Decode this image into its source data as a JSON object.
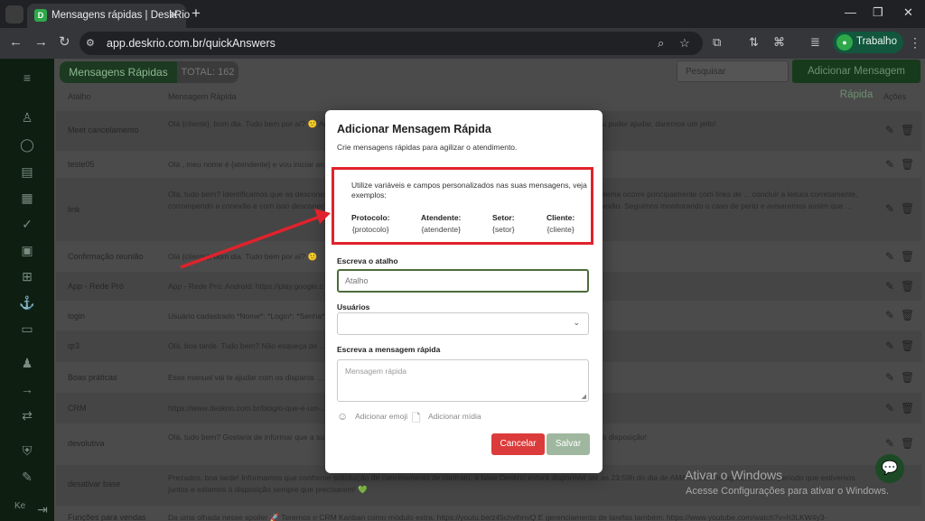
{
  "browser": {
    "tab_title": "Mensagens rápidas | DeskRio",
    "url": "app.deskrio.com.br/quickAnswers",
    "profile_label": "Trabalho",
    "tab_list_icon": "chevron-down-icon",
    "new_tab_label": "+",
    "tab_close_label": "✕"
  },
  "header": {
    "title": "Mensagens Rápidas",
    "total": "TOTAL: 162",
    "search_placeholder": "Pesquisar",
    "add_button": "Adicionar Mensagem Rápida"
  },
  "table": {
    "columns": {
      "shortcut": "Atalho",
      "message": "Mensagem Rápida",
      "actions": "Ações"
    },
    "rows": [
      {
        "shortcut": "Meet cancelamento",
        "message": "Olá {cliente}, bom dia. Tudo bem por aí? 🙂 Aqui é {atendente} ... ssem eu consigo entender melhor o motivo da decisão e se eu puder ajudar, daremos um jeito!"
      },
      {
        "shortcut": "teste05",
        "message": "Olá , meu nome é {atendente} e vou iniciar an..."
      },
      {
        "shortcut": "link",
        "message": "Olá, tudo bem? Identificamos que as desconexões ... relacionada ao recurso de Link Preview (pré-visualização de links). O problema ocorre principalmente com links de ... concluir a leitura corretamente, corrompendo a conexão e com isso desconectando o qr code. Lembramos que ... ativas viáveis e garantir a estabilidade da conexão. Seguimos monitorando o caso de perto e avisaremos assim que ..."
      },
      {
        "shortcut": "Confirmação reunião",
        "message": "Olá {cliente}, bom dia. Tudo bem por aí? 🙂"
      },
      {
        "shortcut": "App - Rede Pró",
        "message": "App - Rede Pro: Android: https://play.google.c ... https://apps.apple.com/br/app/pr%C3%B3map-deskrio/id6615065020"
      },
      {
        "shortcut": "login",
        "message": "Usuário cadastrado *Nome*: *Login*: *Senha*"
      },
      {
        "shortcut": "qr3",
        "message": "Olá, boa tarde. Tudo bem? Não esqueça de ... uma mensagem automática_"
      },
      {
        "shortcut": "Boas práticas",
        "message": "Esse manual vai te ajudar com os disparos ..."
      },
      {
        "shortcut": "CRM",
        "message": "https://www.deskrio.com.br/blog/o-que-e-um-..."
      },
      {
        "shortcut": "devolutiva",
        "message": "Olá, tudo bem? Gostaria de informar que a su... esso. Caso tenha qualquer dúvida ou precise de mais algum suporte, estamos à disposição!"
      },
      {
        "shortcut": "desativar base",
        "message": "Prezados, boa tarde! Informamos que conforme solicitação de cancelamento de contrato, a base Deskrio estará disponível até as 23:59h do dia de AMA ... Deskrio agradece esse período que estivemos juntos e estamos à disposição sempre que precisarem! 💚"
      },
      {
        "shortcut": "Funções para vendas",
        "message": "Da uma olhada nesse spoiler 🚀 Teremos o CRM Kanban como módulo extra: https://youtu.be/z45chvlhnvQ E gerenciamento de tarefas também: https://www.youtube.com/watch?v=h3LKW4y3-"
      }
    ]
  },
  "modal": {
    "title": "Adicionar Mensagem Rápida",
    "subtitle": "Crie mensagens rápidas para agilizar o atendimento.",
    "variables_intro": "Utilize variáveis e campos personalizados nas suas mensagens, veja exemplos:",
    "variables": [
      {
        "name": "Protocolo:",
        "value": "{protocolo}"
      },
      {
        "name": "Atendente:",
        "value": "{atendente}"
      },
      {
        "name": "Setor:",
        "value": "{setor}"
      },
      {
        "name": "Cliente:",
        "value": "{cliente}"
      }
    ],
    "shortcut_label": "Escreva o atalho",
    "shortcut_placeholder": "Atalho",
    "users_label": "Usuários",
    "message_label": "Escreva a mensagem rápida",
    "message_placeholder": "Mensagem rápida",
    "add_emoji": "Adicionar emoji",
    "add_media": "Adicionar mídia",
    "cancel": "Cancelar",
    "save": "Salvar",
    "highlight_color": "#e0222c"
  },
  "watermark": {
    "line1": "Ativar o Windows",
    "line2": "Acesse Configurações para ativar o Windows."
  },
  "sidebar": {
    "footer": "Ke"
  },
  "colors": {
    "brand_green": "#2ea84a",
    "sidebar_bg": "#0e1f12",
    "cancel_red": "#dc3b3b",
    "save_green": "#9fb79e"
  }
}
